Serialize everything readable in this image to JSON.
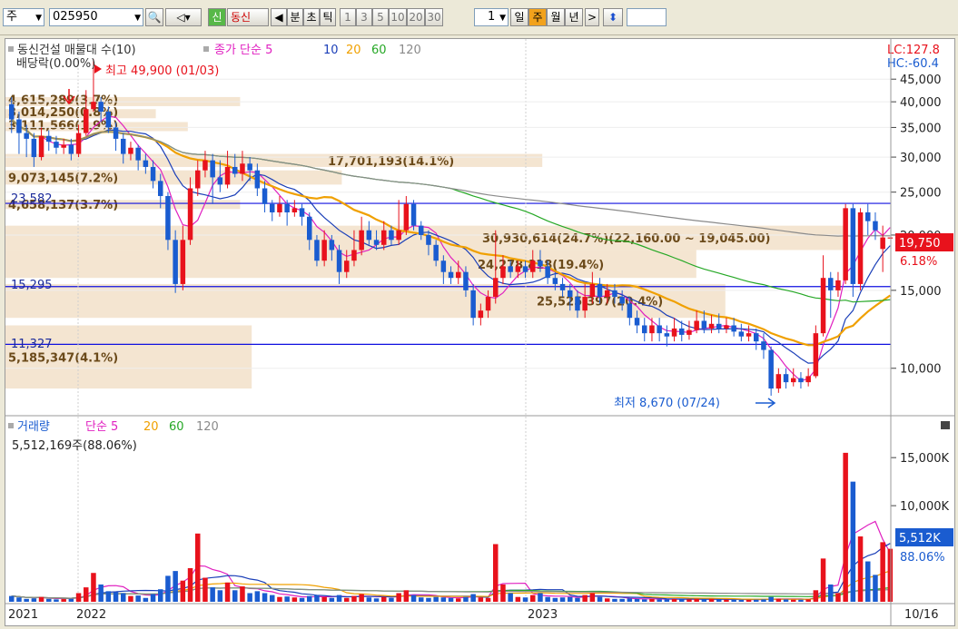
{
  "toolbar": {
    "market": "주",
    "code": "025950",
    "sin": "신",
    "dongsin": "동신",
    "periods": [
      "분",
      "초",
      "틱",
      "1",
      "3",
      "5",
      "10",
      "20",
      "30"
    ],
    "period_count": "1",
    "day": "일",
    "week": "주",
    "month": "월",
    "year": "년"
  },
  "price_panel": {
    "legend_name": "동신건설 매물대 수(10)",
    "legend_price": "종가 단순 5",
    "legend_ma": [
      "10",
      "20",
      "60",
      "120"
    ],
    "lc": "LC:127.8",
    "hc": "HC:-60.4",
    "dividend": "배당락(0.00%)",
    "high_label": "최고 49,900 (01/03)",
    "low_label": "최저 8,670 (07/24)",
    "current_price": "19,750",
    "current_pct": "6.18%",
    "hlines": [
      "23,582",
      "15,295",
      "11,327"
    ],
    "y_ticks": [
      "45,000",
      "40,000",
      "35,000",
      "30,000",
      "25,000",
      "20,000",
      "15,000",
      "10,000"
    ]
  },
  "volume_panel": {
    "legend_name": "거래량",
    "legend_ma_label": "단순 5",
    "legend_ma": [
      "20",
      "60",
      "120"
    ],
    "summary": "5,512,169주(88.06%)",
    "current": "5,512K",
    "current_pct": "88.06%",
    "y_ticks": [
      "15,000K",
      "10,000K"
    ]
  },
  "x_labels": [
    "2021",
    "2022",
    "2023"
  ],
  "date_label": "10/16",
  "colors": {
    "up": "#e8121c",
    "down": "#1a5cd0",
    "ma5": "#e020c0",
    "ma10": "#1b3fb8",
    "ma20": "#f0a000",
    "ma60": "#26a826",
    "ma120": "#8a8a8a",
    "profile": "#f3e2cc",
    "hline": "#1010e0"
  },
  "chart_data": {
    "type": "candlestick",
    "y_range": [
      8000,
      47000
    ],
    "volume_range_k": [
      0,
      17000
    ],
    "volume_profile": [
      {
        "low": 40000,
        "high": 41000,
        "label": "4,615,289(3.7%)"
      },
      {
        "low": 37500,
        "high": 38500,
        "label": "3,014,250(0.8%)"
      },
      {
        "low": 35000,
        "high": 36000,
        "label": "3,111,566(1.9%)"
      },
      {
        "low": 28500,
        "high": 30500,
        "label": "17,701,193(14.1%)"
      },
      {
        "low": 26000,
        "high": 28000,
        "label": "9,073,145(7.2%)"
      },
      {
        "low": 23000,
        "high": 24000,
        "label": "4,658,137(3.7%)"
      },
      {
        "low": 18500,
        "high": 21000,
        "label": "30,930,614(24.7%)(22,160.00 ~ 19,045.00)"
      },
      {
        "low": 16000,
        "high": 18500,
        "label": "24,278,818(19.4%)"
      },
      {
        "low": 13000,
        "high": 15500,
        "label": "25,525,397(20.4%)"
      },
      {
        "low": 9000,
        "high": 12500,
        "label": "5,185,347(4.1%)"
      }
    ],
    "candles": [
      {
        "o": 39500,
        "c": 36500,
        "h": 41000,
        "l": 34000,
        "v": 600
      },
      {
        "o": 36500,
        "c": 34000,
        "h": 38000,
        "l": 30500,
        "v": 450
      },
      {
        "o": 34000,
        "c": 33000,
        "h": 35500,
        "l": 30000,
        "v": 300
      },
      {
        "o": 33000,
        "c": 30000,
        "h": 34000,
        "l": 28500,
        "v": 350
      },
      {
        "o": 30000,
        "c": 33500,
        "h": 35000,
        "l": 29500,
        "v": 500
      },
      {
        "o": 33500,
        "c": 32500,
        "h": 34500,
        "l": 31000,
        "v": 300
      },
      {
        "o": 32500,
        "c": 31500,
        "h": 33500,
        "l": 30500,
        "v": 250
      },
      {
        "o": 31500,
        "c": 32000,
        "h": 33000,
        "l": 30500,
        "v": 280
      },
      {
        "o": 32000,
        "c": 30500,
        "h": 33000,
        "l": 29500,
        "v": 300
      },
      {
        "o": 30500,
        "c": 34000,
        "h": 35500,
        "l": 30000,
        "v": 900
      },
      {
        "o": 34000,
        "c": 38500,
        "h": 42500,
        "l": 33500,
        "v": 1500
      },
      {
        "o": 38500,
        "c": 40000,
        "h": 49900,
        "l": 38000,
        "v": 3000
      },
      {
        "o": 40000,
        "c": 38000,
        "h": 41000,
        "l": 36000,
        "v": 1800
      },
      {
        "o": 38000,
        "c": 35000,
        "h": 39000,
        "l": 34000,
        "v": 1100
      },
      {
        "o": 35000,
        "c": 33000,
        "h": 36000,
        "l": 31000,
        "v": 1000
      },
      {
        "o": 33000,
        "c": 30500,
        "h": 34000,
        "l": 29000,
        "v": 900
      },
      {
        "o": 30500,
        "c": 31500,
        "h": 32500,
        "l": 29500,
        "v": 600
      },
      {
        "o": 31500,
        "c": 29500,
        "h": 32000,
        "l": 28000,
        "v": 650
      },
      {
        "o": 29500,
        "c": 28500,
        "h": 30500,
        "l": 27500,
        "v": 400
      },
      {
        "o": 28500,
        "c": 26500,
        "h": 29500,
        "l": 25500,
        "v": 800
      },
      {
        "o": 26500,
        "c": 24500,
        "h": 27500,
        "l": 23000,
        "v": 1300
      },
      {
        "o": 24500,
        "c": 19500,
        "h": 25000,
        "l": 18500,
        "v": 2700
      },
      {
        "o": 19500,
        "c": 15500,
        "h": 20500,
        "l": 14800,
        "v": 3200
      },
      {
        "o": 15500,
        "c": 19500,
        "h": 21000,
        "l": 15000,
        "v": 2200
      },
      {
        "o": 19500,
        "c": 25500,
        "h": 27000,
        "l": 19000,
        "v": 3500
      },
      {
        "o": 25500,
        "c": 28000,
        "h": 29500,
        "l": 24500,
        "v": 7100
      },
      {
        "o": 28000,
        "c": 29500,
        "h": 31000,
        "l": 27000,
        "v": 2500
      },
      {
        "o": 29500,
        "c": 27000,
        "h": 30500,
        "l": 23500,
        "v": 1500
      },
      {
        "o": 27000,
        "c": 26000,
        "h": 29500,
        "l": 25000,
        "v": 1200
      },
      {
        "o": 26000,
        "c": 28500,
        "h": 31000,
        "l": 25500,
        "v": 2000
      },
      {
        "o": 28500,
        "c": 27500,
        "h": 30500,
        "l": 27000,
        "v": 1200
      },
      {
        "o": 27500,
        "c": 29000,
        "h": 31000,
        "l": 26500,
        "v": 1600
      },
      {
        "o": 29000,
        "c": 28000,
        "h": 30000,
        "l": 26500,
        "v": 900
      },
      {
        "o": 28000,
        "c": 25500,
        "h": 29000,
        "l": 24500,
        "v": 1100
      },
      {
        "o": 25500,
        "c": 23500,
        "h": 26500,
        "l": 22500,
        "v": 900
      },
      {
        "o": 23500,
        "c": 22500,
        "h": 24000,
        "l": 21500,
        "v": 700
      },
      {
        "o": 22500,
        "c": 23500,
        "h": 24500,
        "l": 22000,
        "v": 500
      },
      {
        "o": 23500,
        "c": 22500,
        "h": 24000,
        "l": 21000,
        "v": 550
      },
      {
        "o": 22500,
        "c": 23000,
        "h": 24000,
        "l": 22000,
        "v": 450
      },
      {
        "o": 23000,
        "c": 22000,
        "h": 23500,
        "l": 21000,
        "v": 400
      },
      {
        "o": 22000,
        "c": 19500,
        "h": 22500,
        "l": 18500,
        "v": 600
      },
      {
        "o": 19500,
        "c": 17500,
        "h": 20000,
        "l": 17000,
        "v": 700
      },
      {
        "o": 17500,
        "c": 19500,
        "h": 20500,
        "l": 17000,
        "v": 500
      },
      {
        "o": 19500,
        "c": 18500,
        "h": 20000,
        "l": 17500,
        "v": 400
      },
      {
        "o": 18500,
        "c": 16500,
        "h": 19000,
        "l": 15500,
        "v": 700
      },
      {
        "o": 16500,
        "c": 17500,
        "h": 18500,
        "l": 16000,
        "v": 400
      },
      {
        "o": 17500,
        "c": 18500,
        "h": 20500,
        "l": 17000,
        "v": 600
      },
      {
        "o": 18500,
        "c": 20500,
        "h": 22000,
        "l": 18000,
        "v": 800
      },
      {
        "o": 20500,
        "c": 19500,
        "h": 21500,
        "l": 19000,
        "v": 450
      },
      {
        "o": 19500,
        "c": 19000,
        "h": 20500,
        "l": 18500,
        "v": 350
      },
      {
        "o": 19000,
        "c": 20500,
        "h": 21500,
        "l": 18500,
        "v": 500
      },
      {
        "o": 20500,
        "c": 19500,
        "h": 21000,
        "l": 19000,
        "v": 400
      },
      {
        "o": 19500,
        "c": 20500,
        "h": 24000,
        "l": 19000,
        "v": 900
      },
      {
        "o": 20500,
        "c": 23500,
        "h": 24500,
        "l": 20000,
        "v": 1200
      },
      {
        "o": 23500,
        "c": 21000,
        "h": 24000,
        "l": 20500,
        "v": 700
      },
      {
        "o": 21000,
        "c": 20000,
        "h": 21500,
        "l": 19500,
        "v": 450
      },
      {
        "o": 20000,
        "c": 19000,
        "h": 20500,
        "l": 18000,
        "v": 400
      },
      {
        "o": 19000,
        "c": 17500,
        "h": 19500,
        "l": 17000,
        "v": 500
      },
      {
        "o": 17500,
        "c": 16500,
        "h": 18000,
        "l": 15500,
        "v": 450
      },
      {
        "o": 16500,
        "c": 16000,
        "h": 17000,
        "l": 15500,
        "v": 400
      },
      {
        "o": 16000,
        "c": 16500,
        "h": 17500,
        "l": 15500,
        "v": 350
      },
      {
        "o": 16500,
        "c": 15000,
        "h": 17000,
        "l": 14500,
        "v": 500
      },
      {
        "o": 15000,
        "c": 13000,
        "h": 15500,
        "l": 12500,
        "v": 800
      },
      {
        "o": 13000,
        "c": 13500,
        "h": 14000,
        "l": 12500,
        "v": 450
      },
      {
        "o": 13500,
        "c": 14500,
        "h": 15000,
        "l": 13000,
        "v": 400
      },
      {
        "o": 14500,
        "c": 16000,
        "h": 20500,
        "l": 14000,
        "v": 6000
      },
      {
        "o": 16000,
        "c": 17000,
        "h": 18000,
        "l": 15500,
        "v": 1800
      },
      {
        "o": 17000,
        "c": 16500,
        "h": 17500,
        "l": 16000,
        "v": 900
      },
      {
        "o": 16500,
        "c": 17000,
        "h": 17500,
        "l": 16000,
        "v": 500
      },
      {
        "o": 17000,
        "c": 16500,
        "h": 17500,
        "l": 16000,
        "v": 450
      },
      {
        "o": 16500,
        "c": 17500,
        "h": 18500,
        "l": 16000,
        "v": 700
      },
      {
        "o": 17500,
        "c": 17000,
        "h": 18500,
        "l": 16500,
        "v": 900
      },
      {
        "o": 17000,
        "c": 16000,
        "h": 17500,
        "l": 15500,
        "v": 500
      },
      {
        "o": 16000,
        "c": 15500,
        "h": 16500,
        "l": 15000,
        "v": 400
      },
      {
        "o": 15500,
        "c": 15000,
        "h": 16000,
        "l": 14500,
        "v": 450
      },
      {
        "o": 15000,
        "c": 14500,
        "h": 15500,
        "l": 13500,
        "v": 500
      },
      {
        "o": 14500,
        "c": 13500,
        "h": 15000,
        "l": 13000,
        "v": 400
      },
      {
        "o": 13500,
        "c": 14500,
        "h": 15500,
        "l": 13000,
        "v": 700
      },
      {
        "o": 14500,
        "c": 15500,
        "h": 16500,
        "l": 14000,
        "v": 900
      },
      {
        "o": 15500,
        "c": 14500,
        "h": 16000,
        "l": 14000,
        "v": 500
      },
      {
        "o": 14500,
        "c": 15000,
        "h": 15500,
        "l": 14000,
        "v": 350
      },
      {
        "o": 15000,
        "c": 14500,
        "h": 15500,
        "l": 14000,
        "v": 300
      },
      {
        "o": 14500,
        "c": 14000,
        "h": 15000,
        "l": 13500,
        "v": 300
      },
      {
        "o": 14000,
        "c": 13000,
        "h": 14500,
        "l": 12500,
        "v": 350
      },
      {
        "o": 13000,
        "c": 12500,
        "h": 13500,
        "l": 12000,
        "v": 300
      },
      {
        "o": 12500,
        "c": 12000,
        "h": 13000,
        "l": 11500,
        "v": 250
      },
      {
        "o": 12000,
        "c": 12500,
        "h": 13000,
        "l": 11500,
        "v": 300
      },
      {
        "o": 12500,
        "c": 12000,
        "h": 13000,
        "l": 11500,
        "v": 250
      },
      {
        "o": 12000,
        "c": 11800,
        "h": 12500,
        "l": 11200,
        "v": 250
      },
      {
        "o": 11800,
        "c": 12300,
        "h": 13000,
        "l": 11500,
        "v": 300
      },
      {
        "o": 12300,
        "c": 11900,
        "h": 12800,
        "l": 11500,
        "v": 250
      },
      {
        "o": 11900,
        "c": 12200,
        "h": 12800,
        "l": 11600,
        "v": 250
      },
      {
        "o": 12200,
        "c": 12800,
        "h": 13500,
        "l": 12000,
        "v": 300
      },
      {
        "o": 12800,
        "c": 12300,
        "h": 13500,
        "l": 12000,
        "v": 250
      },
      {
        "o": 12300,
        "c": 12600,
        "h": 13200,
        "l": 12000,
        "v": 300
      },
      {
        "o": 12600,
        "c": 12300,
        "h": 13300,
        "l": 12000,
        "v": 250
      },
      {
        "o": 12300,
        "c": 12500,
        "h": 13000,
        "l": 12000,
        "v": 220
      },
      {
        "o": 12500,
        "c": 12100,
        "h": 13000,
        "l": 11800,
        "v": 220
      },
      {
        "o": 12100,
        "c": 11800,
        "h": 12600,
        "l": 11500,
        "v": 220
      },
      {
        "o": 11800,
        "c": 12000,
        "h": 12500,
        "l": 11500,
        "v": 200
      },
      {
        "o": 12000,
        "c": 11500,
        "h": 12300,
        "l": 11000,
        "v": 220
      },
      {
        "o": 11500,
        "c": 11000,
        "h": 12000,
        "l": 10500,
        "v": 250
      },
      {
        "o": 11000,
        "c": 9000,
        "h": 11200,
        "l": 8670,
        "v": 500
      },
      {
        "o": 9000,
        "c": 9700,
        "h": 10000,
        "l": 8800,
        "v": 300
      },
      {
        "o": 9700,
        "c": 9300,
        "h": 10000,
        "l": 9000,
        "v": 250
      },
      {
        "o": 9300,
        "c": 9500,
        "h": 10000,
        "l": 9100,
        "v": 220
      },
      {
        "o": 9500,
        "c": 9300,
        "h": 9800,
        "l": 9000,
        "v": 220
      },
      {
        "o": 9300,
        "c": 9600,
        "h": 10000,
        "l": 9100,
        "v": 250
      },
      {
        "o": 9600,
        "c": 12000,
        "h": 12500,
        "l": 9500,
        "v": 1200
      },
      {
        "o": 12000,
        "c": 16000,
        "h": 18000,
        "l": 11800,
        "v": 4500
      },
      {
        "o": 16000,
        "c": 15000,
        "h": 16500,
        "l": 13000,
        "v": 1800
      },
      {
        "o": 15000,
        "c": 15800,
        "h": 16500,
        "l": 14500,
        "v": 900
      },
      {
        "o": 15800,
        "c": 23000,
        "h": 23500,
        "l": 15500,
        "v": 15500
      },
      {
        "o": 23000,
        "c": 15500,
        "h": 23500,
        "l": 14500,
        "v": 12500
      },
      {
        "o": 15500,
        "c": 22500,
        "h": 23000,
        "l": 15000,
        "v": 6800
      },
      {
        "o": 22500,
        "c": 21500,
        "h": 23500,
        "l": 20000,
        "v": 4200
      },
      {
        "o": 21500,
        "c": 20500,
        "h": 22500,
        "l": 19500,
        "v": 2800
      },
      {
        "o": 18600,
        "c": 19750,
        "h": 21000,
        "l": 16500,
        "v": 6200
      },
      {
        "o": 19750,
        "c": 19750,
        "h": 19750,
        "l": 19750,
        "v": 5512
      }
    ]
  }
}
